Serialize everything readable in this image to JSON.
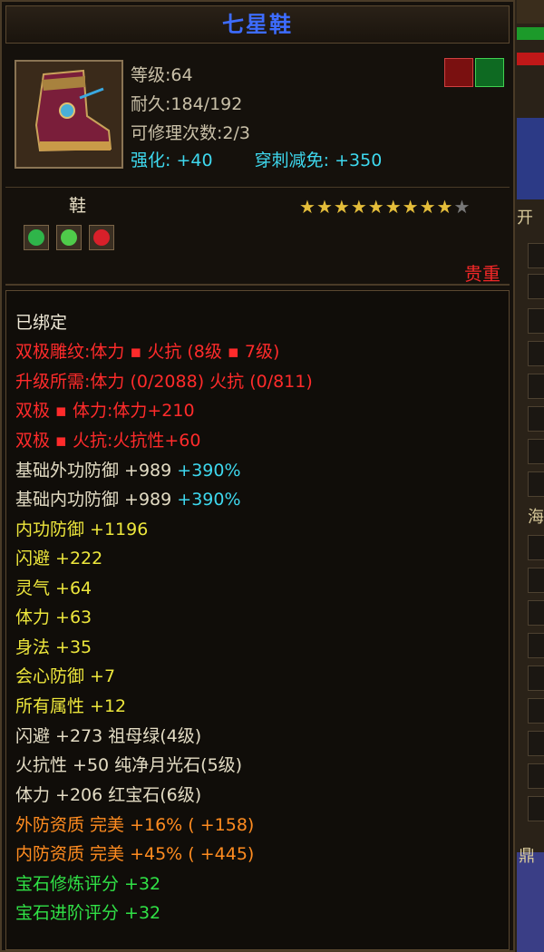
{
  "title": "七星鞋",
  "item": {
    "level": "等级:64",
    "durability": "耐久:184/192",
    "repairs": "可修理次数:2/3",
    "enhance_label": "强化:",
    "enhance_value": "+40",
    "pierce_label": "穿刺减免:",
    "pierce_value": "+350",
    "type": "鞋",
    "stars_filled": 9,
    "stars_total": 10,
    "quality": "贵重"
  },
  "attributes": {
    "bound": "已绑定",
    "lines_red": [
      "双极雕纹:体力 ▪ 火抗 (8级 ▪ 7级)",
      "升级所需:体力 (0/2088)  火抗 (0/811)",
      "双极 ▪ 体力:体力+210",
      "双极 ▪ 火抗:火抗性+60"
    ],
    "base_outer": "基础外功防御 +989",
    "base_outer_pct": "+390%",
    "base_inner": "基础内功防御 +989",
    "base_inner_pct": "+390%",
    "lines_yellow": [
      "内功防御 +1196",
      "闪避 +222",
      "灵气 +64",
      "体力 +63",
      "身法 +35",
      "会心防御 +7",
      "所有属性 +12"
    ],
    "gem_lines": [
      "闪避 +273 祖母绿(4级)",
      "火抗性 +50 纯净月光石(5级)",
      "体力 +206 红宝石(6级)"
    ],
    "orange_lines": [
      "外防资质  完美 +16% ( +158)",
      "内防资质  完美 +45% ( +445)"
    ],
    "green_lines": [
      "宝石修炼评分 +32",
      "宝石进阶评分 +32"
    ]
  },
  "side": {
    "glyph_1": "开",
    "glyph_2": "海",
    "glyph_3": "鼎"
  }
}
